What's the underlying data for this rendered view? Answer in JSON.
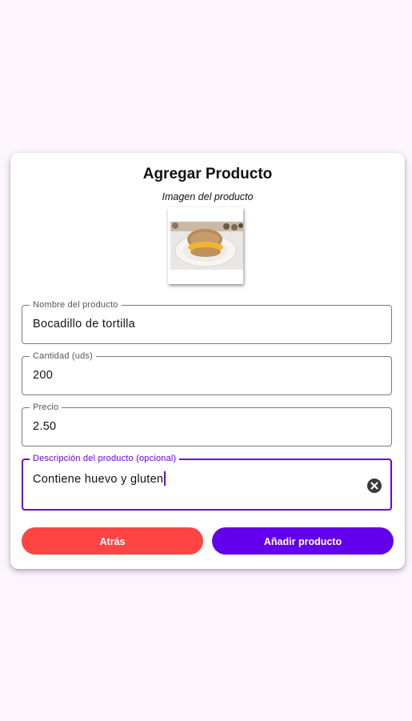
{
  "dialog": {
    "title": "Agregar Producto",
    "image_label": "Imagen del producto"
  },
  "fields": {
    "name": {
      "label": "Nombre del producto",
      "value": "Bocadillo de tortilla"
    },
    "quantity": {
      "label": "Cantidad (uds)",
      "value": "200"
    },
    "price": {
      "label": "Precio",
      "value": "2.50"
    },
    "description": {
      "label": "Descripción del producto (opcional)",
      "value": "Contiene huevo y gluten"
    }
  },
  "buttons": {
    "back": "Atrás",
    "add": "Añadir producto"
  },
  "colors": {
    "background": "#FCF5FD",
    "accent": "#6200EE",
    "danger": "#FF4444"
  },
  "icons": {
    "clear": "clear-icon"
  }
}
